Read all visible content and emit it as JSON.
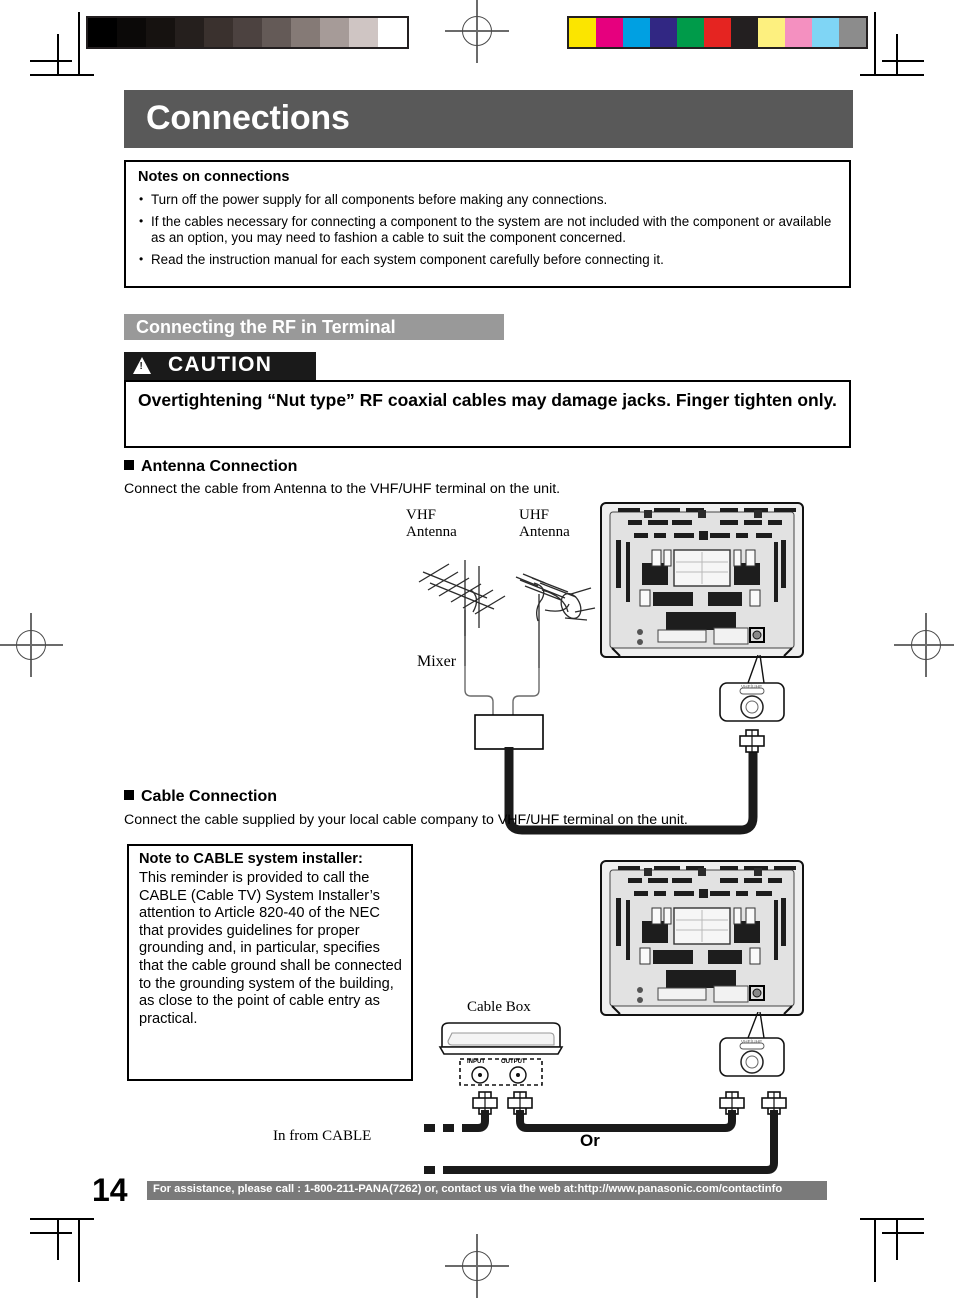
{
  "page": {
    "number": "14",
    "title": "Connections"
  },
  "notes": {
    "heading": "Notes on connections",
    "items": [
      "Turn off the power supply for all components before making any connections.",
      "If the cables necessary for connecting a component to the system are not included with the component or available as an option, you may need to fashion a cable to suit the component concerned.",
      "Read the instruction manual for each system component carefully before connecting it."
    ]
  },
  "section": {
    "heading": "Connecting the RF in Terminal"
  },
  "caution": {
    "label": "CAUTION",
    "text": "Overtightening “Nut type” RF coaxial cables may damage jacks. Finger tighten only."
  },
  "antenna_connection": {
    "heading": "Antenna Connection",
    "body": "Connect the cable from Antenna to the VHF/UHF terminal on the unit.",
    "labels": {
      "vhf": "VHF\nAntenna",
      "vhf_line1": "VHF",
      "vhf_line2": "Antenna",
      "uhf_line1": "UHF",
      "uhf_line2": "Antenna",
      "mixer": "Mixer",
      "jack": "VHF/UHF"
    }
  },
  "cable_connection": {
    "heading": "Cable Connection",
    "body": "Connect the cable supplied by your local cable company to VHF/UHF terminal on the unit.",
    "note": {
      "heading": "Note to CABLE system installer:",
      "text": "This reminder is provided to call the CABLE (Cable TV) System Installer’s attention to Article 820-40 of the NEC that provides guidelines for proper grounding and, in particular, specifies that the cable ground shall be connected to the grounding system of the building, as close to the point of cable entry as practical."
    },
    "labels": {
      "cable_box": "Cable Box",
      "input": "INPUT",
      "output": "OUTPUT",
      "in_from_cable": "In from CABLE",
      "or": "Or",
      "jack": "VHF/UHF"
    }
  },
  "footer": {
    "text": "For assistance, please call : 1-800-211-PANA(7262) or, contact us via the web at:http://www.panasonic.com/contactinfo"
  },
  "print_marks": {
    "grayscale_bar": [
      "#000000",
      "#0b0908",
      "#161210",
      "#251f1d",
      "#3a312e",
      "#4c4240",
      "#645a57",
      "#857a76",
      "#a69b98",
      "#cfc5c3",
      "#ffffff"
    ],
    "color_bar": [
      "#fbe500",
      "#e6007e",
      "#00a0e2",
      "#312783",
      "#009b4a",
      "#e52421",
      "#231f20",
      "#fdf07f",
      "#f490c0",
      "#7fd5f5",
      "#8c8c8c"
    ]
  },
  "colors": {
    "title_bar": "#595959",
    "section_bar": "#999999",
    "caution_bar": "#1a1a1a",
    "footer_bar": "#7a7a7a"
  }
}
